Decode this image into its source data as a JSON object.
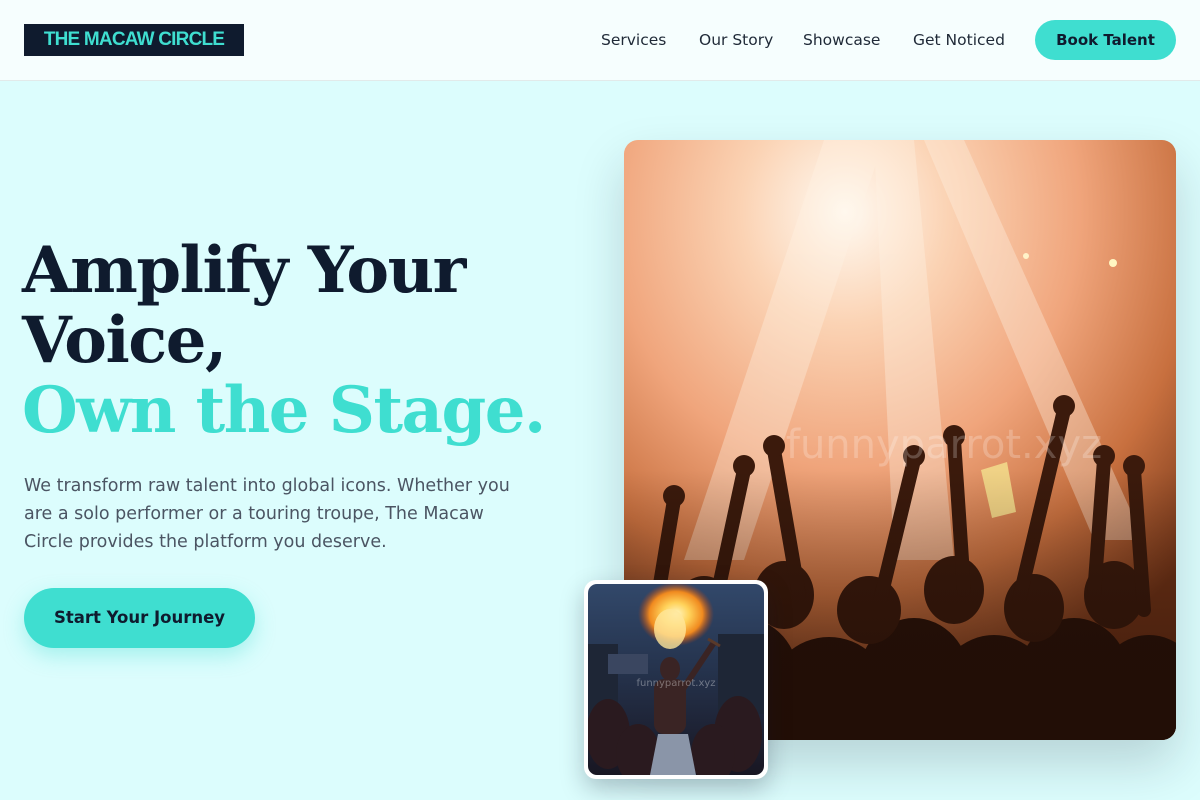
{
  "header": {
    "logo_text": "THE MACAW CIRCLE",
    "nav": [
      "Services",
      "Our Story",
      "Showcase",
      "Get Noticed"
    ],
    "cta_label": "Book Talent"
  },
  "hero": {
    "headline_line1": "Amplify Your",
    "headline_line2": "Voice,",
    "headline_accent": "Own the Stage.",
    "subtext": "We transform raw talent into global icons. Whether you are a solo performer or a touring troupe, The Macaw Circle provides the platform you deserve.",
    "cta_label": "Start Your Journey",
    "main_image_watermark": "funnyparrot.xyz",
    "thumb_image_watermark": "funnyparrot.xyz"
  },
  "colors": {
    "accent": "#3fded0",
    "navy": "#0f1b2e",
    "background": "#dcfdfd",
    "body_text": "#4b5563"
  }
}
